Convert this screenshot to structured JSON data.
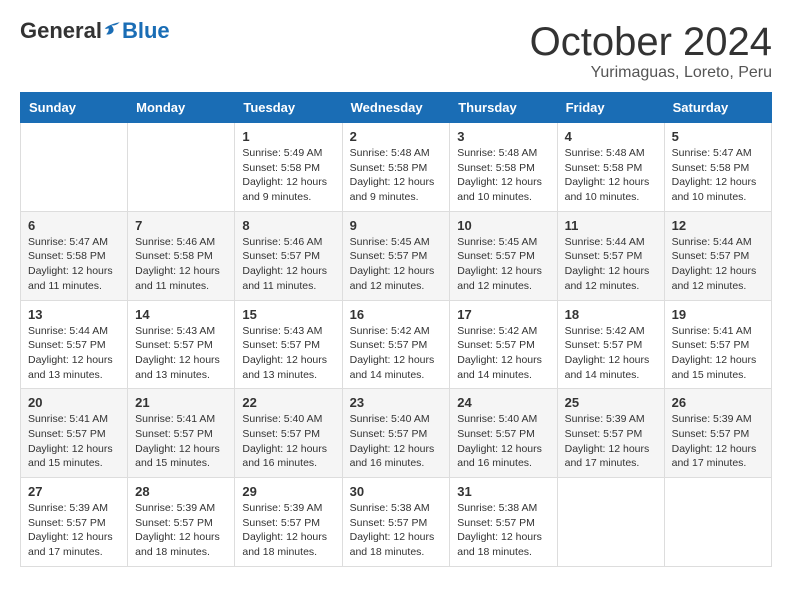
{
  "header": {
    "logo_general": "General",
    "logo_blue": "Blue",
    "month_title": "October 2024",
    "subtitle": "Yurimaguas, Loreto, Peru"
  },
  "days_of_week": [
    "Sunday",
    "Monday",
    "Tuesday",
    "Wednesday",
    "Thursday",
    "Friday",
    "Saturday"
  ],
  "weeks": [
    [
      {
        "day": "",
        "sunrise": "",
        "sunset": "",
        "daylight": ""
      },
      {
        "day": "",
        "sunrise": "",
        "sunset": "",
        "daylight": ""
      },
      {
        "day": "1",
        "sunrise": "Sunrise: 5:49 AM",
        "sunset": "Sunset: 5:58 PM",
        "daylight": "Daylight: 12 hours and 9 minutes."
      },
      {
        "day": "2",
        "sunrise": "Sunrise: 5:48 AM",
        "sunset": "Sunset: 5:58 PM",
        "daylight": "Daylight: 12 hours and 9 minutes."
      },
      {
        "day": "3",
        "sunrise": "Sunrise: 5:48 AM",
        "sunset": "Sunset: 5:58 PM",
        "daylight": "Daylight: 12 hours and 10 minutes."
      },
      {
        "day": "4",
        "sunrise": "Sunrise: 5:48 AM",
        "sunset": "Sunset: 5:58 PM",
        "daylight": "Daylight: 12 hours and 10 minutes."
      },
      {
        "day": "5",
        "sunrise": "Sunrise: 5:47 AM",
        "sunset": "Sunset: 5:58 PM",
        "daylight": "Daylight: 12 hours and 10 minutes."
      }
    ],
    [
      {
        "day": "6",
        "sunrise": "Sunrise: 5:47 AM",
        "sunset": "Sunset: 5:58 PM",
        "daylight": "Daylight: 12 hours and 11 minutes."
      },
      {
        "day": "7",
        "sunrise": "Sunrise: 5:46 AM",
        "sunset": "Sunset: 5:58 PM",
        "daylight": "Daylight: 12 hours and 11 minutes."
      },
      {
        "day": "8",
        "sunrise": "Sunrise: 5:46 AM",
        "sunset": "Sunset: 5:57 PM",
        "daylight": "Daylight: 12 hours and 11 minutes."
      },
      {
        "day": "9",
        "sunrise": "Sunrise: 5:45 AM",
        "sunset": "Sunset: 5:57 PM",
        "daylight": "Daylight: 12 hours and 12 minutes."
      },
      {
        "day": "10",
        "sunrise": "Sunrise: 5:45 AM",
        "sunset": "Sunset: 5:57 PM",
        "daylight": "Daylight: 12 hours and 12 minutes."
      },
      {
        "day": "11",
        "sunrise": "Sunrise: 5:44 AM",
        "sunset": "Sunset: 5:57 PM",
        "daylight": "Daylight: 12 hours and 12 minutes."
      },
      {
        "day": "12",
        "sunrise": "Sunrise: 5:44 AM",
        "sunset": "Sunset: 5:57 PM",
        "daylight": "Daylight: 12 hours and 12 minutes."
      }
    ],
    [
      {
        "day": "13",
        "sunrise": "Sunrise: 5:44 AM",
        "sunset": "Sunset: 5:57 PM",
        "daylight": "Daylight: 12 hours and 13 minutes."
      },
      {
        "day": "14",
        "sunrise": "Sunrise: 5:43 AM",
        "sunset": "Sunset: 5:57 PM",
        "daylight": "Daylight: 12 hours and 13 minutes."
      },
      {
        "day": "15",
        "sunrise": "Sunrise: 5:43 AM",
        "sunset": "Sunset: 5:57 PM",
        "daylight": "Daylight: 12 hours and 13 minutes."
      },
      {
        "day": "16",
        "sunrise": "Sunrise: 5:42 AM",
        "sunset": "Sunset: 5:57 PM",
        "daylight": "Daylight: 12 hours and 14 minutes."
      },
      {
        "day": "17",
        "sunrise": "Sunrise: 5:42 AM",
        "sunset": "Sunset: 5:57 PM",
        "daylight": "Daylight: 12 hours and 14 minutes."
      },
      {
        "day": "18",
        "sunrise": "Sunrise: 5:42 AM",
        "sunset": "Sunset: 5:57 PM",
        "daylight": "Daylight: 12 hours and 14 minutes."
      },
      {
        "day": "19",
        "sunrise": "Sunrise: 5:41 AM",
        "sunset": "Sunset: 5:57 PM",
        "daylight": "Daylight: 12 hours and 15 minutes."
      }
    ],
    [
      {
        "day": "20",
        "sunrise": "Sunrise: 5:41 AM",
        "sunset": "Sunset: 5:57 PM",
        "daylight": "Daylight: 12 hours and 15 minutes."
      },
      {
        "day": "21",
        "sunrise": "Sunrise: 5:41 AM",
        "sunset": "Sunset: 5:57 PM",
        "daylight": "Daylight: 12 hours and 15 minutes."
      },
      {
        "day": "22",
        "sunrise": "Sunrise: 5:40 AM",
        "sunset": "Sunset: 5:57 PM",
        "daylight": "Daylight: 12 hours and 16 minutes."
      },
      {
        "day": "23",
        "sunrise": "Sunrise: 5:40 AM",
        "sunset": "Sunset: 5:57 PM",
        "daylight": "Daylight: 12 hours and 16 minutes."
      },
      {
        "day": "24",
        "sunrise": "Sunrise: 5:40 AM",
        "sunset": "Sunset: 5:57 PM",
        "daylight": "Daylight: 12 hours and 16 minutes."
      },
      {
        "day": "25",
        "sunrise": "Sunrise: 5:39 AM",
        "sunset": "Sunset: 5:57 PM",
        "daylight": "Daylight: 12 hours and 17 minutes."
      },
      {
        "day": "26",
        "sunrise": "Sunrise: 5:39 AM",
        "sunset": "Sunset: 5:57 PM",
        "daylight": "Daylight: 12 hours and 17 minutes."
      }
    ],
    [
      {
        "day": "27",
        "sunrise": "Sunrise: 5:39 AM",
        "sunset": "Sunset: 5:57 PM",
        "daylight": "Daylight: 12 hours and 17 minutes."
      },
      {
        "day": "28",
        "sunrise": "Sunrise: 5:39 AM",
        "sunset": "Sunset: 5:57 PM",
        "daylight": "Daylight: 12 hours and 18 minutes."
      },
      {
        "day": "29",
        "sunrise": "Sunrise: 5:39 AM",
        "sunset": "Sunset: 5:57 PM",
        "daylight": "Daylight: 12 hours and 18 minutes."
      },
      {
        "day": "30",
        "sunrise": "Sunrise: 5:38 AM",
        "sunset": "Sunset: 5:57 PM",
        "daylight": "Daylight: 12 hours and 18 minutes."
      },
      {
        "day": "31",
        "sunrise": "Sunrise: 5:38 AM",
        "sunset": "Sunset: 5:57 PM",
        "daylight": "Daylight: 12 hours and 18 minutes."
      },
      {
        "day": "",
        "sunrise": "",
        "sunset": "",
        "daylight": ""
      },
      {
        "day": "",
        "sunrise": "",
        "sunset": "",
        "daylight": ""
      }
    ]
  ]
}
